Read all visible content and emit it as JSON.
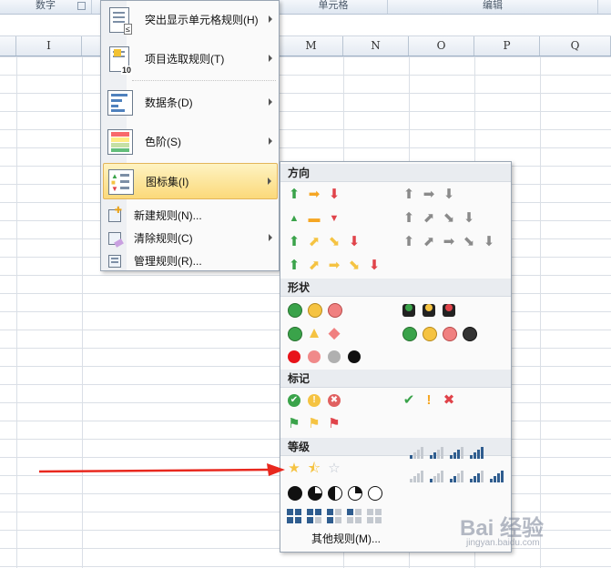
{
  "ribbon": {
    "group_number": "数字",
    "group_cells": "单元格",
    "group_edit": "编辑"
  },
  "columns": [
    "I",
    "M",
    "N",
    "O",
    "P",
    "Q"
  ],
  "menu": {
    "items": [
      {
        "label": "突出显示单元格规则(H)"
      },
      {
        "label": "项目选取规则(T)"
      },
      {
        "label": "数据条(D)"
      },
      {
        "label": "色阶(S)"
      },
      {
        "label": "图标集(I)"
      },
      {
        "label": "新建规则(N)..."
      },
      {
        "label": "清除规则(C)"
      },
      {
        "label": "管理规则(R)..."
      }
    ]
  },
  "submenu": {
    "sections": [
      "方向",
      "形状",
      "标记",
      "等级"
    ],
    "more_rules": "其他规则(M)..."
  },
  "watermark": {
    "text": "Bai 经验",
    "sub": "jingyan.baidu.com"
  },
  "colors": {
    "green": "#3aa34a",
    "yellow": "#f5c342",
    "red": "#e0434a",
    "gray": "#8a8a8a",
    "blue": "#2f5d8f",
    "accent_arrow": "#e8281e"
  }
}
